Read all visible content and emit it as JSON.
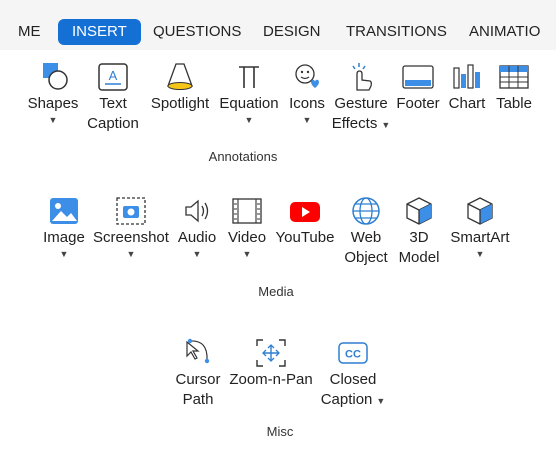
{
  "tabs": [
    {
      "label": "ME"
    },
    {
      "label": "INSERT"
    },
    {
      "label": "QUESTIONS"
    },
    {
      "label": "DESIGN"
    },
    {
      "label": "TRANSITIONS"
    },
    {
      "label": "ANIMATIO"
    }
  ],
  "annotations": {
    "group_label": "Annotations",
    "buttons": [
      {
        "line1": "Shapes",
        "icon": "shapes-icon",
        "has_menu": true
      },
      {
        "line1": "Text",
        "line2": "Caption",
        "icon": "text-caption-icon"
      },
      {
        "line1": "Spotlight",
        "icon": "spotlight-icon"
      },
      {
        "line1": "Equation",
        "icon": "equation-icon",
        "has_menu": true
      },
      {
        "line1": "Icons",
        "icon": "icons-icon",
        "has_menu": true
      },
      {
        "line1": "Gesture",
        "line2": "Effects",
        "icon": "gesture-icon",
        "has_menu": true
      },
      {
        "line1": "Footer",
        "icon": "footer-icon"
      },
      {
        "line1": "Chart",
        "icon": "chart-icon"
      },
      {
        "line1": "Table",
        "icon": "table-icon"
      }
    ]
  },
  "media": {
    "group_label": "Media",
    "buttons": [
      {
        "line1": "Image",
        "icon": "image-icon",
        "has_menu": true
      },
      {
        "line1": "Screenshot",
        "icon": "screenshot-icon",
        "has_menu": true
      },
      {
        "line1": "Audio",
        "icon": "audio-icon",
        "has_menu": true
      },
      {
        "line1": "Video",
        "icon": "video-icon",
        "has_menu": true
      },
      {
        "line1": "YouTube",
        "icon": "youtube-icon"
      },
      {
        "line1": "Web",
        "line2": "Object",
        "icon": "web-object-icon"
      },
      {
        "line1": "3D",
        "line2": "Model",
        "icon": "3d-model-icon"
      },
      {
        "line1": "SmartArt",
        "icon": "smartart-icon",
        "has_menu": true
      }
    ]
  },
  "misc": {
    "group_label": "Misc",
    "buttons": [
      {
        "line1": "Cursor",
        "line2": "Path",
        "icon": "cursor-path-icon"
      },
      {
        "line1": "Zoom-n-Pan",
        "icon": "zoom-n-pan-icon"
      },
      {
        "line1": "Closed",
        "line2": "Caption",
        "icon": "closed-caption-icon",
        "has_menu": true
      }
    ]
  },
  "colors": {
    "accent": "#1570d6",
    "icon_blue": "#2f7fd0",
    "youtube_red": "#ff0000"
  }
}
